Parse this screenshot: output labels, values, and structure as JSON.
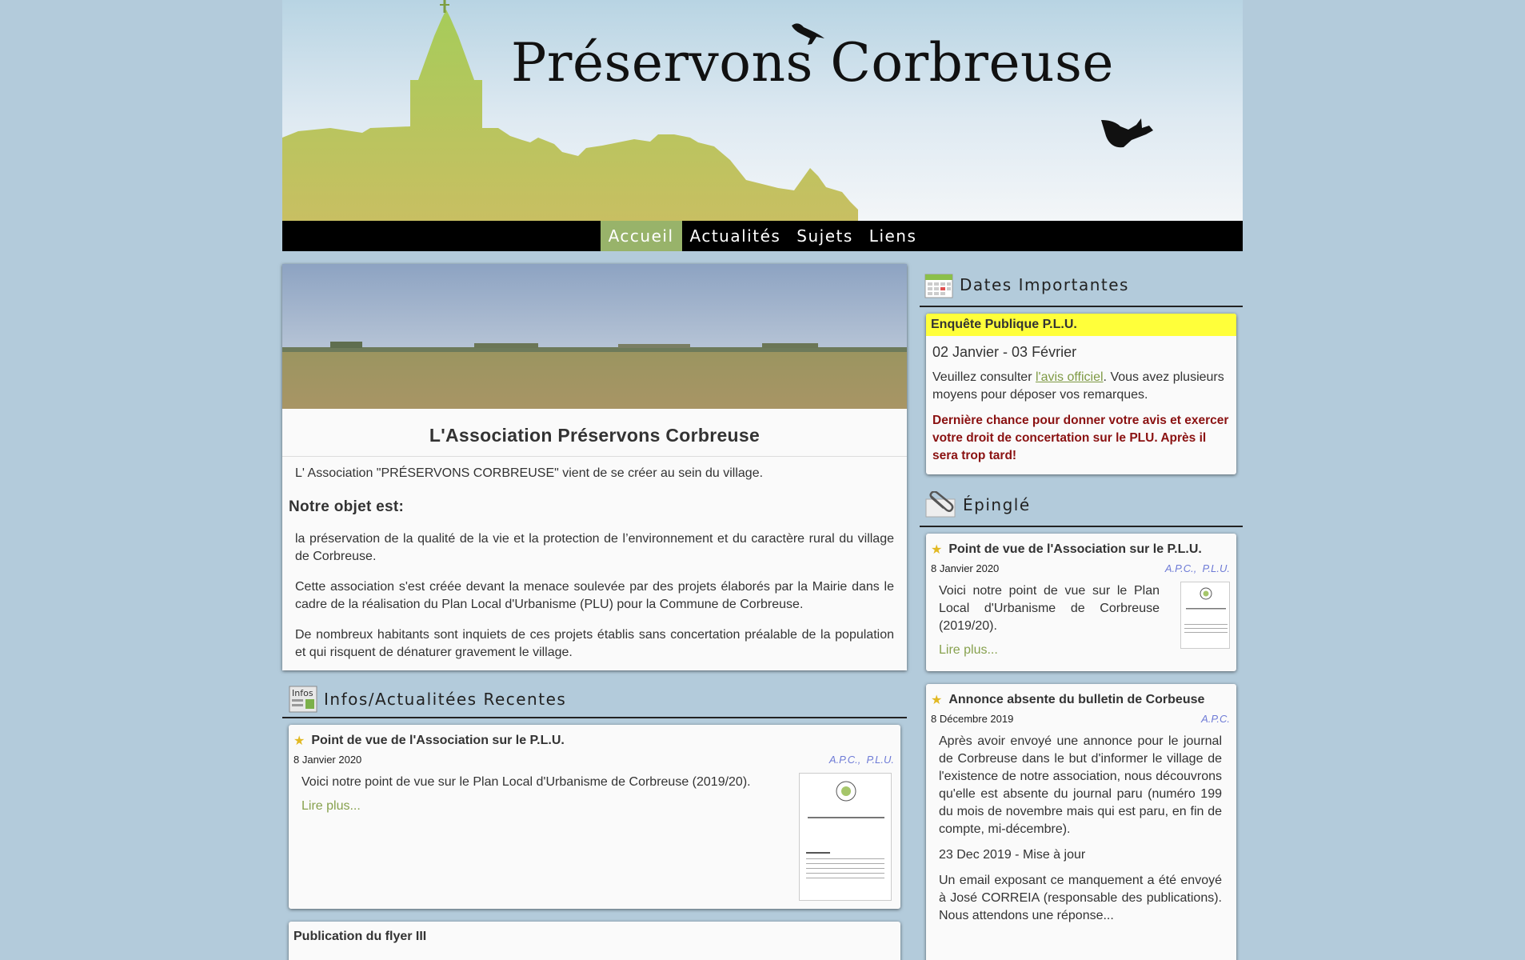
{
  "site": {
    "title": "Préservons Corbreuse"
  },
  "nav": {
    "items": [
      "Accueil",
      "Actualités",
      "Sujets",
      "Liens"
    ],
    "active": "Accueil"
  },
  "intro": {
    "heading": "L'Association Préservons Corbreuse",
    "lead": "L' Association \"PRÉSERVONS CORBREUSE\" vient de se créer au sein du village.",
    "subheading": "Notre objet est:",
    "paragraphs": [
      "la préservation de la qualité de la vie et la protection de l’environnement et du caractère rural du village de Corbreuse.",
      "Cette association s'est créée devant la menace soulevée par des projets élaborés par la Mairie dans le cadre de la réalisation du Plan Local d'Urbanisme (PLU) pour la Commune de Corbreuse.",
      "De nombreux habitants sont inquiets de ces projets établis sans concertation préalable de la population et qui risquent de dénaturer gravement le village."
    ]
  },
  "news": {
    "heading": "Infos/Actualitées Recentes",
    "icon_label": "Infos",
    "posts": [
      {
        "title": "Point de vue de l'Association sur le P.L.U.",
        "date": "8 Janvier 2020",
        "tags": [
          "A.P.C.",
          "P.L.U."
        ],
        "body": "Voici notre point de vue sur le Plan Local d'Urbanisme de Corbreuse (2019/20).",
        "more": "Lire plus..."
      },
      {
        "title": "Publication du flyer III"
      }
    ]
  },
  "dates": {
    "heading": "Dates Importantes",
    "event": {
      "title": "Enquête Publique P.L.U.",
      "range": "02 Janvier - 03 Février",
      "text_before": "Veuillez consulter ",
      "link": "l'avis officiel",
      "text_after": ". Vous avez plusieurs moyens pour déposer vos remarques.",
      "warning": "Dernière chance pour donner votre avis et exercer votre droit de concertation sur le PLU. Après il sera trop tard!"
    }
  },
  "pinned": {
    "heading": "Épinglé",
    "posts": [
      {
        "title": "Point de vue de l'Association sur le P.L.U.",
        "date": "8 Janvier 2020",
        "tags": [
          "A.P.C.",
          "P.L.U."
        ],
        "body": "Voici notre point de vue sur le Plan Local d'Urbanisme de Corbreuse (2019/20).",
        "more": "Lire plus..."
      },
      {
        "title": "Annonce absente du bulletin de Corbeuse",
        "date": "8 Décembre 2019",
        "tags": [
          "A.P.C."
        ],
        "body": "Après avoir envoyé une annonce pour le journal de Corbreuse dans le but d'informer le village de l'existence de notre association, nous découvrons qu'elle est absente du journal paru (numéro 199 du mois de novembre mais qui est paru, en fin de compte, mi-décembre).",
        "update": "23 Dec 2019 - Mise à jour",
        "body2": "Un email exposant ce manquement a été envoyé à José CORREIA (responsable des publications). Nous attendons une réponse..."
      }
    ]
  },
  "colors": {
    "background": "#b3cbdb",
    "nav": "#000000",
    "nav_active": "#98b36a",
    "tag": "#6e7bd6",
    "link": "#87a14e",
    "highlight": "#ffff3a",
    "warning": "#8a1111"
  }
}
